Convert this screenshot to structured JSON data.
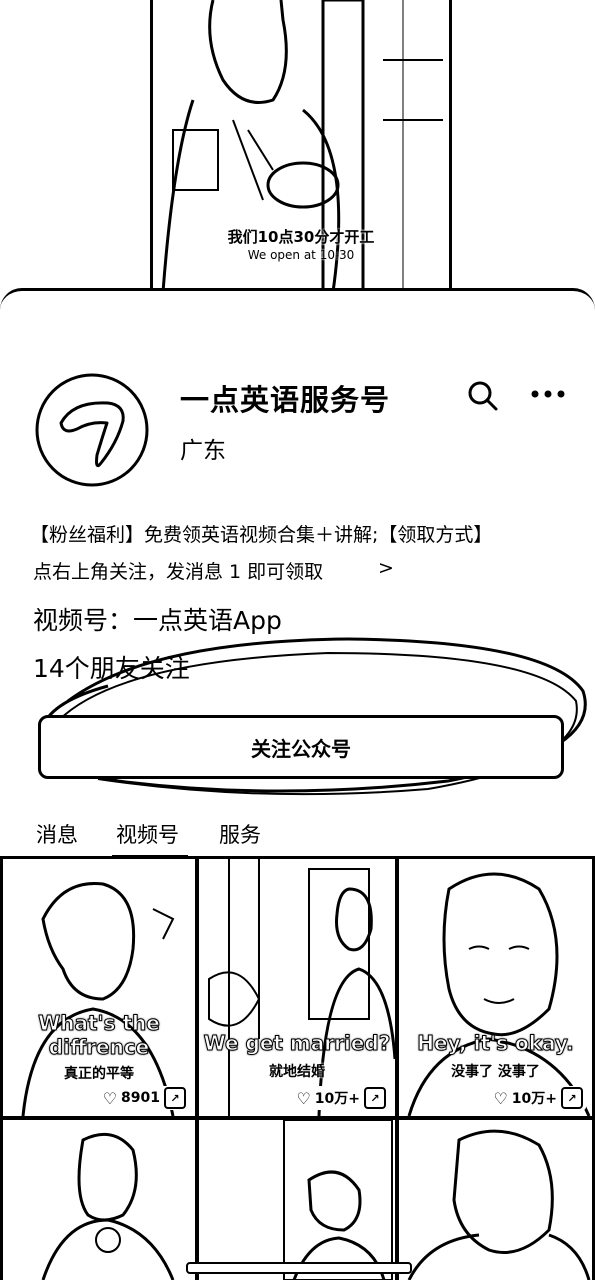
{
  "video_preview": {
    "subtitle_cn": "我们10点30分才开工",
    "subtitle_en": "We open at 10:30"
  },
  "account": {
    "name": "一点英语服务号",
    "region": "广东",
    "intro_line1": "【粉丝福利】免费领英语视频合集＋讲解;【领取方式】",
    "intro_line2": "点右上角关注，发消息 1 即可领取",
    "intro_more": ">",
    "channel": "视频号：一点英语App",
    "friends": "14个朋友关注",
    "follow_button": "关注公众号"
  },
  "tabs": [
    {
      "label": "消息",
      "active": false
    },
    {
      "label": "视频号",
      "active": true
    },
    {
      "label": "服务",
      "active": false
    }
  ],
  "videos": [
    {
      "en": "What's the diffrence",
      "cn": "真正的平等",
      "likes": "8901"
    },
    {
      "en": "We get married?",
      "cn": "就地结婚",
      "likes": "10万+"
    },
    {
      "en": "Hey, it's okay.",
      "cn": "没事了 没事了",
      "likes": "10万+"
    },
    {
      "en": "",
      "cn": "",
      "likes": ""
    },
    {
      "en": "",
      "cn": "",
      "likes": ""
    },
    {
      "en": "",
      "cn": "",
      "likes": ""
    }
  ],
  "icons": {
    "search": "search-icon",
    "more": "more-icon",
    "heart": "heart-icon",
    "share": "share-icon"
  }
}
